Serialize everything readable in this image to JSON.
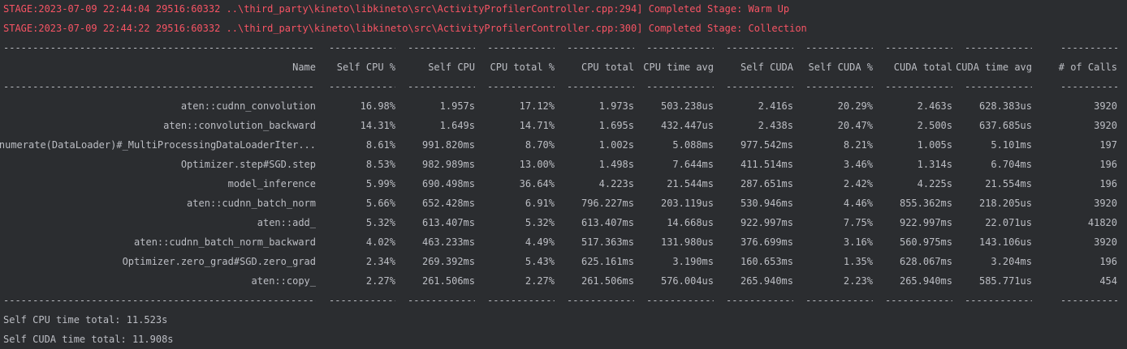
{
  "console": {
    "stage_lines": [
      "STAGE:2023-07-09 22:44:04 29516:60332 ..\\third_party\\kineto\\libkineto\\src\\ActivityProfilerController.cpp:294] Completed Stage: Warm Up",
      "STAGE:2023-07-09 22:44:22 29516:60332 ..\\third_party\\kineto\\libkineto\\src\\ActivityProfilerController.cpp:300] Completed Stage: Collection"
    ],
    "separator": "-------------------------------------------------------",
    "columns": [
      "Name",
      "Self CPU %",
      "Self CPU",
      "CPU total %",
      "CPU total",
      "CPU time avg",
      "Self CUDA",
      "Self CUDA %",
      "CUDA total",
      "CUDA time avg",
      "# of Calls"
    ],
    "rows": [
      [
        "aten::cudnn_convolution",
        "16.98%",
        "1.957s",
        "17.12%",
        "1.973s",
        "503.238us",
        "2.416s",
        "20.29%",
        "2.463s",
        "628.383us",
        "3920"
      ],
      [
        "aten::convolution_backward",
        "14.31%",
        "1.649s",
        "14.71%",
        "1.695s",
        "432.447us",
        "2.438s",
        "20.47%",
        "2.500s",
        "637.685us",
        "3920"
      ],
      [
        "enumerate(DataLoader)#_MultiProcessingDataLoaderIter...",
        "8.61%",
        "991.820ms",
        "8.70%",
        "1.002s",
        "5.088ms",
        "977.542ms",
        "8.21%",
        "1.005s",
        "5.101ms",
        "197"
      ],
      [
        "Optimizer.step#SGD.step",
        "8.53%",
        "982.989ms",
        "13.00%",
        "1.498s",
        "7.644ms",
        "411.514ms",
        "3.46%",
        "1.314s",
        "6.704ms",
        "196"
      ],
      [
        "model_inference",
        "5.99%",
        "690.498ms",
        "36.64%",
        "4.223s",
        "21.544ms",
        "287.651ms",
        "2.42%",
        "4.225s",
        "21.554ms",
        "196"
      ],
      [
        "aten::cudnn_batch_norm",
        "5.66%",
        "652.428ms",
        "6.91%",
        "796.227ms",
        "203.119us",
        "530.946ms",
        "4.46%",
        "855.362ms",
        "218.205us",
        "3920"
      ],
      [
        "aten::add_",
        "5.32%",
        "613.407ms",
        "5.32%",
        "613.407ms",
        "14.668us",
        "922.997ms",
        "7.75%",
        "922.997ms",
        "22.071us",
        "41820"
      ],
      [
        "aten::cudnn_batch_norm_backward",
        "4.02%",
        "463.233ms",
        "4.49%",
        "517.363ms",
        "131.980us",
        "376.699ms",
        "3.16%",
        "560.975ms",
        "143.106us",
        "3920"
      ],
      [
        "Optimizer.zero_grad#SGD.zero_grad",
        "2.34%",
        "269.392ms",
        "5.43%",
        "625.161ms",
        "3.190ms",
        "160.653ms",
        "1.35%",
        "628.067ms",
        "3.204ms",
        "196"
      ],
      [
        "aten::copy_",
        "2.27%",
        "261.506ms",
        "2.27%",
        "261.506ms",
        "576.004us",
        "265.940ms",
        "2.23%",
        "265.940ms",
        "585.771us",
        "454"
      ]
    ],
    "totals": [
      "Self CPU time total: 11.523s",
      "Self CUDA time total: 11.908s"
    ]
  }
}
